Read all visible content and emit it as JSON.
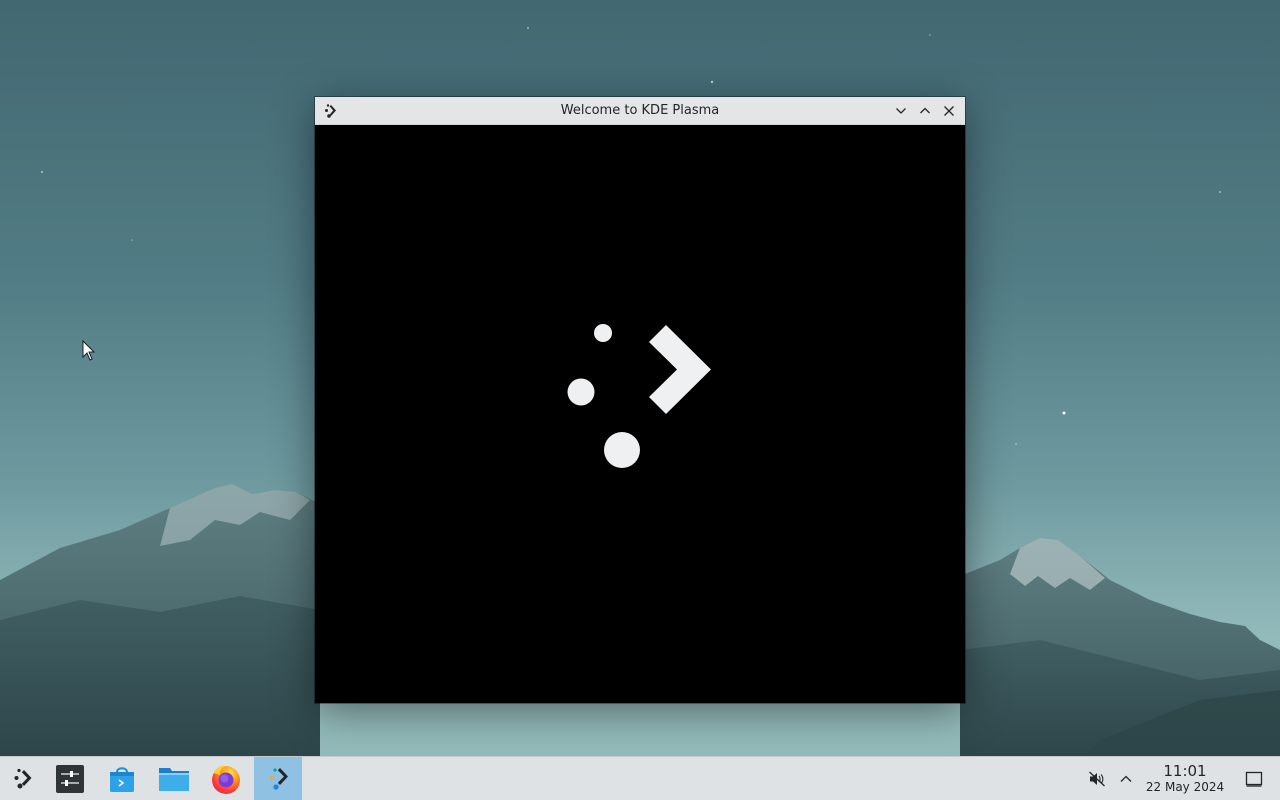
{
  "window": {
    "title": "Welcome to KDE Plasma",
    "icon": "kde-plasma-icon",
    "controls": [
      "minimize-icon",
      "maximize-icon",
      "close-icon"
    ],
    "content_background": "#000000"
  },
  "desktop": {
    "wallpaper": "mountain-range-at-dusk",
    "sky_color": "#4f7780"
  },
  "taskbar": {
    "background": "#dfe2e5",
    "active_highlight": "#8fc1e2",
    "items": [
      {
        "name": "application-launcher",
        "icon": "kde-launcher-icon",
        "active": false
      },
      {
        "name": "system-settings",
        "icon": "settings-sliders-icon",
        "active": false
      },
      {
        "name": "discover",
        "icon": "discover-bag-icon",
        "active": false
      },
      {
        "name": "dolphin-file-manager",
        "icon": "folder-icon",
        "active": false
      },
      {
        "name": "firefox",
        "icon": "firefox-icon",
        "active": false
      },
      {
        "name": "welcome-center",
        "icon": "kde-plasma-icon",
        "active": true
      }
    ],
    "tray": {
      "volume_icon": "volume-muted-icon",
      "expand_icon": "chevron-up-icon"
    },
    "clock": {
      "time": "11:01",
      "date": "22 May 2024"
    },
    "show_desktop_icon": "show-desktop-icon"
  }
}
